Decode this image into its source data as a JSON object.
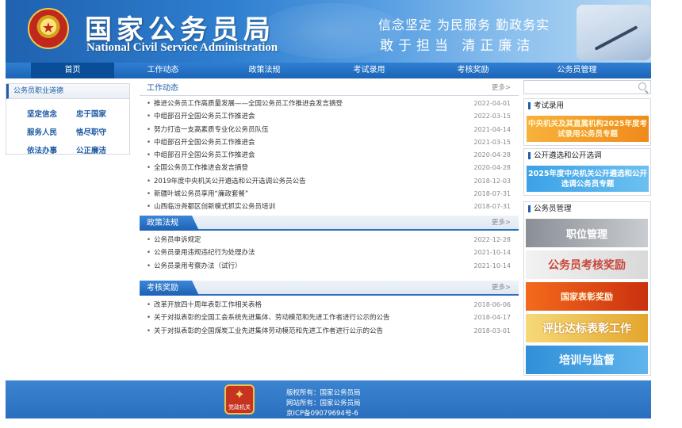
{
  "header": {
    "title_cn": "国家公务员局",
    "title_en": "National Civil Service Administration",
    "emblem_symbol": "★",
    "slogan_line1": "信念坚定  为民服务  勤政务实",
    "slogan_line2": "敢于担当    清正廉洁"
  },
  "nav": {
    "items": [
      "首页",
      "工作动态",
      "政策法规",
      "考试录用",
      "考核奖励",
      "公务员管理"
    ],
    "active_index": 0
  },
  "left": {
    "title": "公务员职业道德",
    "values": [
      "坚定信念",
      "忠于国家",
      "服务人民",
      "恪尽职守",
      "依法办事",
      "公正廉洁"
    ]
  },
  "sections": {
    "work": {
      "title": "工作动态",
      "more": "更多>",
      "items": [
        {
          "text": "推进公务员工作高质量发展——全国公务员工作推进会发言摘登",
          "date": "2022-04-01"
        },
        {
          "text": "中组部召开全国公务员工作推进会",
          "date": "2022-03-15"
        },
        {
          "text": "努力打造一支高素质专业化公务员队伍",
          "date": "2021-04-14"
        },
        {
          "text": "中组部召开全国公务员工作推进会",
          "date": "2021-03-15"
        },
        {
          "text": "中组部召开全国公务员工作推进会",
          "date": "2020-04-28"
        },
        {
          "text": "全国公务员工作推进会发言摘登",
          "date": "2020-04-28"
        },
        {
          "text": "2019年度中央机关公开遴选和公开选调公务员公告",
          "date": "2018-12-03"
        },
        {
          "text": "新疆叶城公务员享用“廉政套餐”",
          "date": "2018-07-31"
        },
        {
          "text": "山西临汾尧都区创新模式抓实公务员培训",
          "date": "2018-07-31"
        }
      ]
    },
    "policy": {
      "title": "政策法规",
      "more": "更多>",
      "items": [
        {
          "text": "公务员申诉规定",
          "date": "2022-12-28"
        },
        {
          "text": "公务员录用违规违纪行为处理办法",
          "date": "2021-10-14"
        },
        {
          "text": "公务员录用考察办法（试行）",
          "date": "2021-10-14"
        }
      ]
    },
    "reward": {
      "title": "考核奖励",
      "more": "更多>",
      "items": [
        {
          "text": "改革开放四十周年表彰工作相关表格",
          "date": "2018-06-06"
        },
        {
          "text": "关于对拟表彰的全国工会系统先进集体、劳动模范和先进工作者进行公示的公告",
          "date": "2018-04-17"
        },
        {
          "text": "关于对拟表彰的全国煤炭工业先进集体劳动模范和先进工作者进行公示的公告",
          "date": "2018-03-01"
        }
      ]
    }
  },
  "right": {
    "search_placeholder": "",
    "exam_title": "考试录用",
    "exam_banner": "中央机关及其直属机构2025年度考试录用公务员专题",
    "select_title": "公开遴选和公开选调",
    "select_banner": "2025年度中央机关公开遴选和公开选调公务员专题",
    "mgmt_title": "公务员管理",
    "tiles": [
      "职位管理",
      "公务员考核奖励",
      "国家表彰奖励",
      "评比达标表彰工作",
      "培训与监督"
    ]
  },
  "footer": {
    "badge_text": "党政机关",
    "copyright": "版权所有：国家公务员局",
    "site": "网站所有：国家公务员局",
    "icp": "京ICP备09079694号-6"
  }
}
